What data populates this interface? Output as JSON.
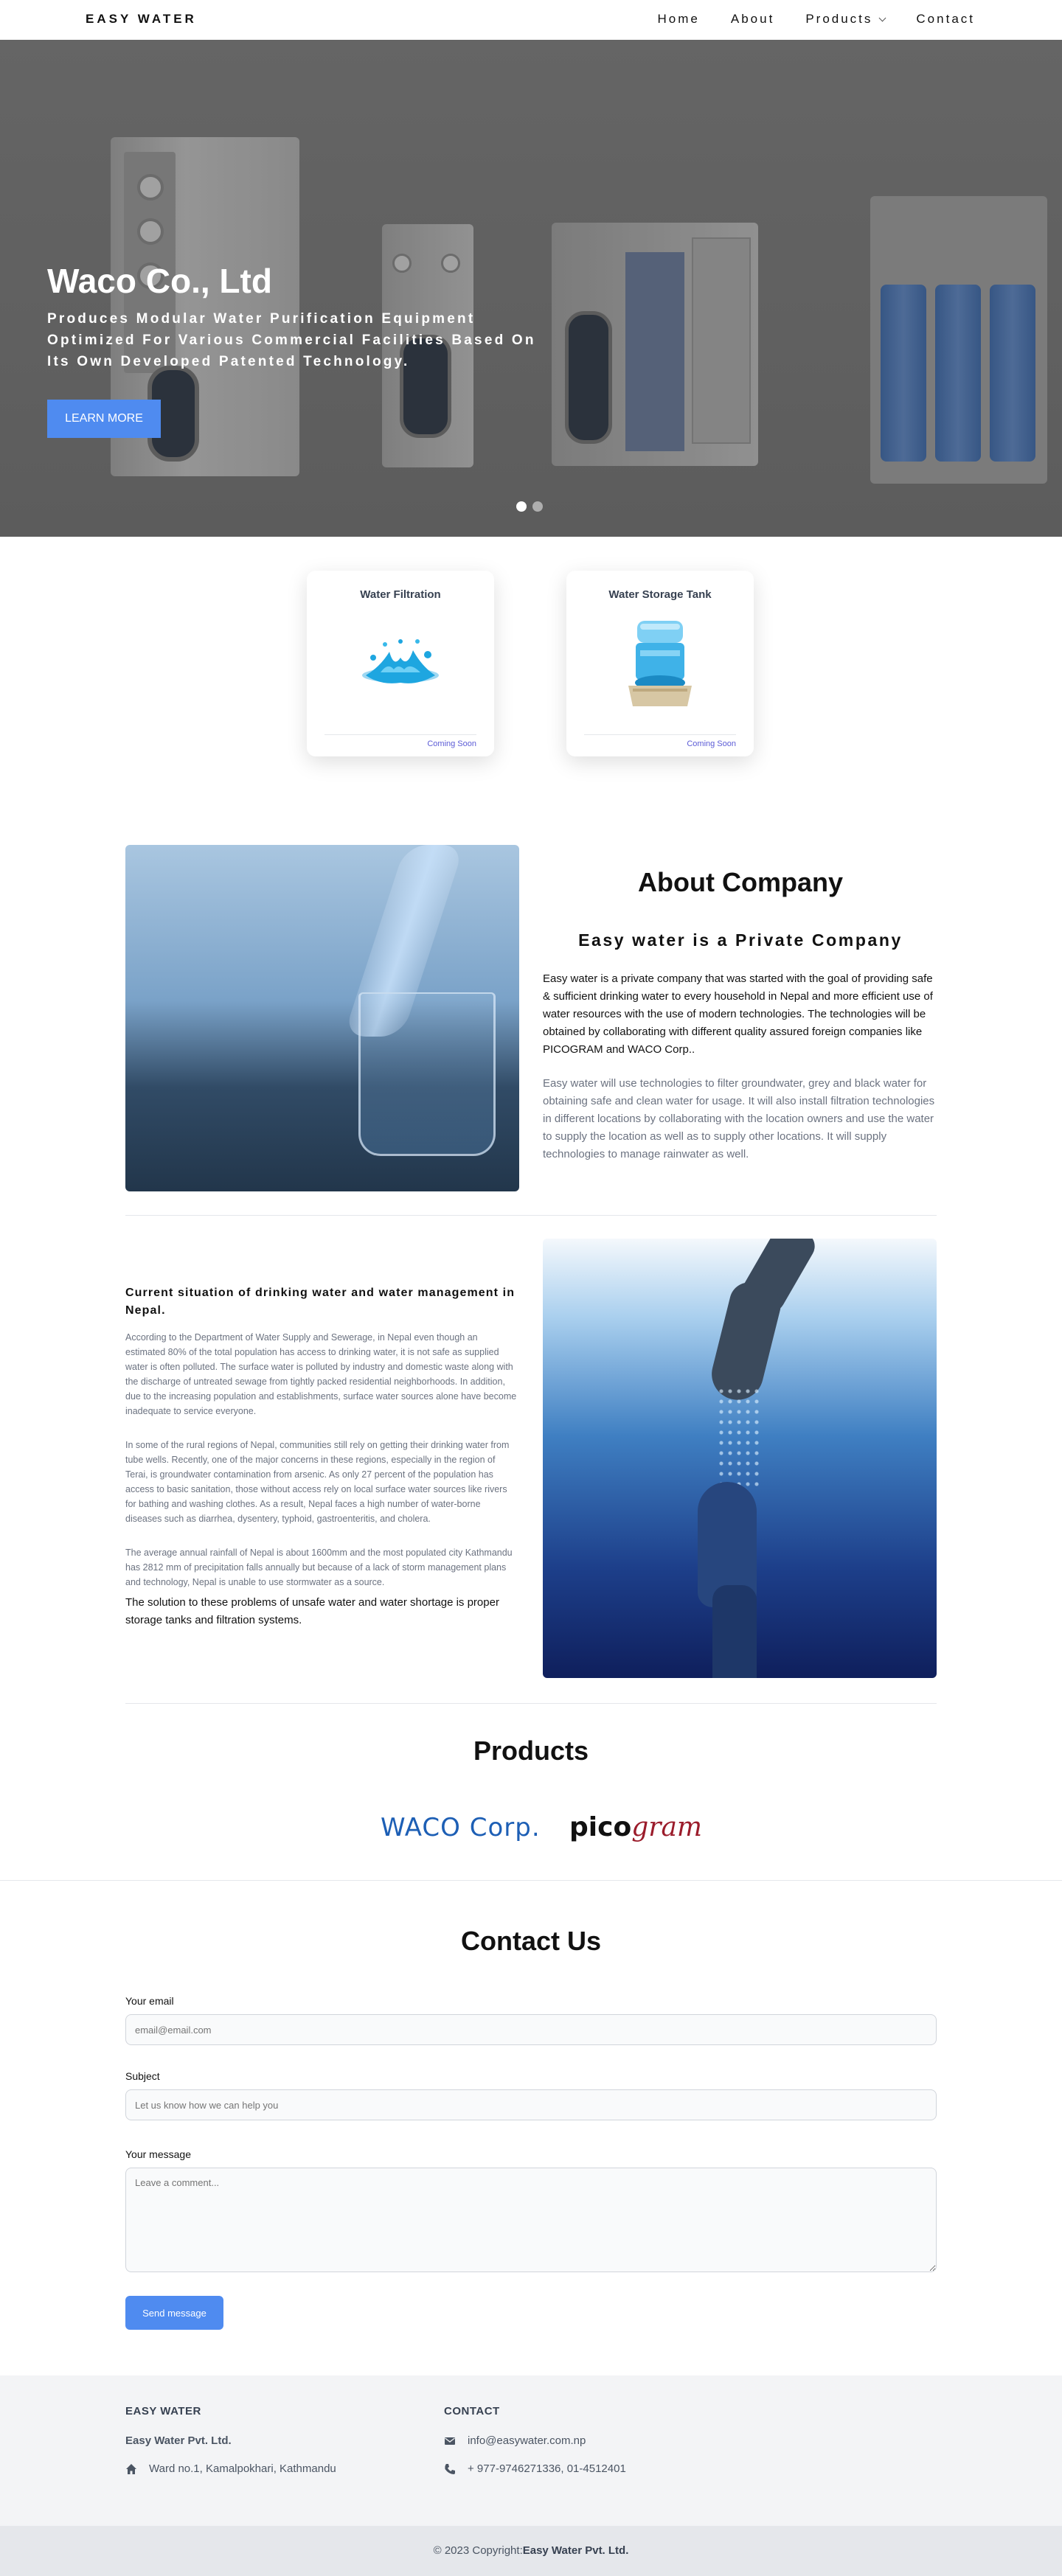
{
  "nav": {
    "brand": "EASY WATER",
    "links": [
      "Home",
      "About",
      "Products",
      "Contact"
    ]
  },
  "hero": {
    "title": "Waco Co., Ltd",
    "subtitle": "Produces Modular Water Purification Equipment Optimized For Various Commercial Facilities Based On Its Own Developed Patented Technology.",
    "button": "LEARN MORE",
    "slides": 2,
    "active_slide": 1
  },
  "services": [
    {
      "title": "Water Filtration",
      "status": "Coming Soon",
      "icon": "water-splash-icon"
    },
    {
      "title": "Water Storage Tank",
      "status": "Coming Soon",
      "icon": "water-dispenser-icon"
    }
  ],
  "about": {
    "heading": "About Company",
    "subheading": "Easy water is a Private Company",
    "p1": "Easy water is a private company that was started with the goal of providing safe & sufficient drinking water to every household in Nepal and more efficient use of water resources with the use of modern technologies. The technologies will be obtained by collaborating with different quality assured foreign companies like PICOGRAM and WACO Corp..",
    "p2": "Easy water will use technologies to filter groundwater, grey and black water for obtaining safe and clean water for usage. It will also install filtration technologies in different locations by collaborating with the location owners and use the water to supply the location as well as to supply other locations. It will supply technologies to manage rainwater as well."
  },
  "situation": {
    "heading": "Current situation of drinking water and water management in Nepal.",
    "p1": "According to the Department of Water Supply and Sewerage, in Nepal even though an estimated 80% of the total population has access to drinking water, it is not safe as supplied water is often polluted. The surface water is polluted by industry and domestic waste along with the discharge of untreated sewage from tightly packed residential neighborhoods. In addition, due to the increasing population and establishments, surface water sources alone have become inadequate to service everyone.",
    "p2": "In some of the rural regions of Nepal, communities still rely on getting their drinking water from tube wells. Recently, one of the major concerns in these regions, especially in the region of Terai, is groundwater contamination from arsenic. As only 27 percent of the population has access to basic sanitation, those without access rely on local surface water sources like rivers for bathing and washing clothes. As a result, Nepal faces a high number of water-borne diseases such as diarrhea, dysentery, typhoid, gastroenteritis, and cholera.",
    "p3": "The average annual rainfall of Nepal is about 1600mm and the most populated city Kathmandu has 2812 mm of precipitation falls annually but because of a lack of storm management plans and technology, Nepal is unable to use stormwater as a source.",
    "conclusion": "The solution to these problems of unsafe water and water shortage is proper storage tanks and filtration systems."
  },
  "products": {
    "heading": "Products",
    "logos": [
      {
        "main": "WACO",
        "suffix": " Corp."
      },
      {
        "main": "pico",
        "suffix": "gram"
      }
    ]
  },
  "contact": {
    "heading": "Contact Us",
    "email_label": "Your email",
    "email_placeholder": "email@email.com",
    "subject_label": "Subject",
    "subject_placeholder": "Let us know how we can help you",
    "message_label": "Your message",
    "message_placeholder": "Leave a comment...",
    "send": "Send message"
  },
  "footer": {
    "brand_heading": "EASY WATER",
    "company": "Easy Water Pvt. Ltd.",
    "address": "Ward no.1, Kamalpokhari, Kathmandu",
    "contact_heading": "CONTACT",
    "email": "info@easywater.com.np",
    "phone": "+ 977-9746271336, 01-4512401",
    "copyright_prefix": "© 2023 Copyright:",
    "copyright_owner": "Easy Water Pvt. Ltd."
  },
  "colors": {
    "accent": "#4f8bf0",
    "hero_overlay": "#6e6e6e",
    "coming_soon": "#5b5bd6"
  }
}
